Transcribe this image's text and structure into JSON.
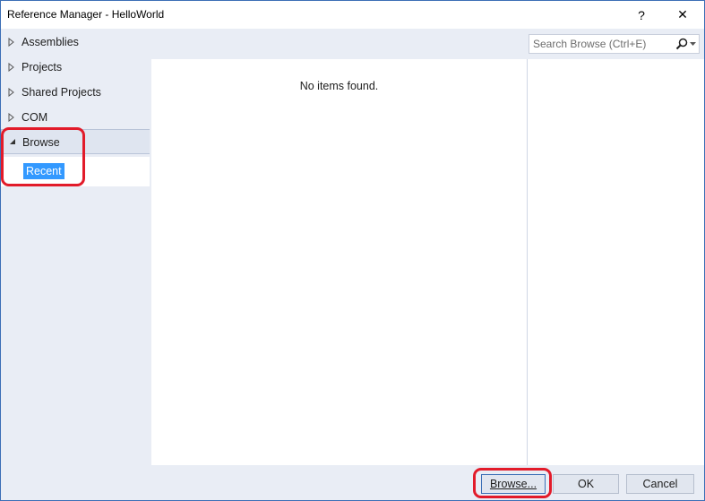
{
  "window": {
    "title": "Reference Manager - HelloWorld",
    "help_label": "?",
    "close_label": "✕"
  },
  "sidebar": {
    "items": [
      {
        "label": "Assemblies",
        "expanded": false
      },
      {
        "label": "Projects",
        "expanded": false
      },
      {
        "label": "Shared Projects",
        "expanded": false
      },
      {
        "label": "COM",
        "expanded": false
      },
      {
        "label": "Browse",
        "expanded": true
      }
    ],
    "sub_items": [
      {
        "label": "Recent",
        "selected": true
      }
    ]
  },
  "search": {
    "placeholder": "Search Browse (Ctrl+E)",
    "value": "",
    "icon": "search-icon",
    "dropdown_icon": "chevron-down-icon"
  },
  "content": {
    "empty_message": "No items found."
  },
  "footer": {
    "browse_label": "Browse...",
    "ok_label": "OK",
    "cancel_label": "Cancel"
  },
  "colors": {
    "accent": "#3399ff",
    "annotation": "#e21b2a",
    "window_border": "#3c6fb6",
    "panel_bg": "#e9edf5"
  }
}
